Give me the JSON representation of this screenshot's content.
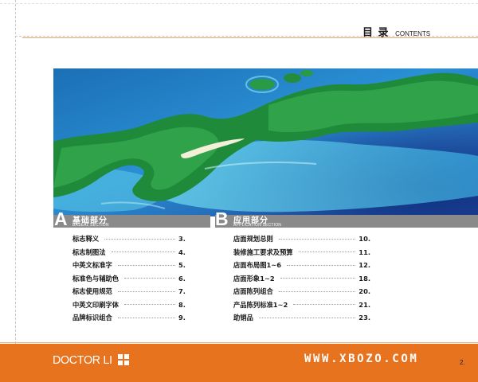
{
  "header": {
    "title_cn": "目 录",
    "title_en": "CONTENTS"
  },
  "section_a": {
    "letter": "A",
    "title_cn": "基础部分",
    "title_en": "BASEAL SECTION",
    "items": [
      {
        "label": "标志释义",
        "page": "3."
      },
      {
        "label": "标志制图法",
        "page": "4."
      },
      {
        "label": "中英文标准字",
        "page": "5."
      },
      {
        "label": "标准色与辅助色",
        "page": "6."
      },
      {
        "label": "标志使用规范",
        "page": "7."
      },
      {
        "label": "中英文印刷字体",
        "page": "8."
      },
      {
        "label": "品牌标识组合",
        "page": "9."
      }
    ]
  },
  "section_b": {
    "letter": "B",
    "title_cn": "应用部分",
    "title_en": "APPLICATION SECTION",
    "items": [
      {
        "label": "店面规划总则",
        "page": "10."
      },
      {
        "label": "装修施工要求及预算",
        "page": "11."
      },
      {
        "label": "店面布局图1~6",
        "page": "12."
      },
      {
        "label": "店面形象1~2",
        "page": "18."
      },
      {
        "label": "店面陈列组合",
        "page": "20."
      },
      {
        "label": "产品陈列标准1~2",
        "page": "21."
      },
      {
        "label": "助销品",
        "page": "23."
      }
    ]
  },
  "footer": {
    "logo_text": "DOCTOR LI",
    "url": "WWW.XBOZO.COM",
    "page_number": "2."
  },
  "colors": {
    "accent_orange": "#e8731f",
    "section_bar_gray": "#8a8a8a"
  }
}
